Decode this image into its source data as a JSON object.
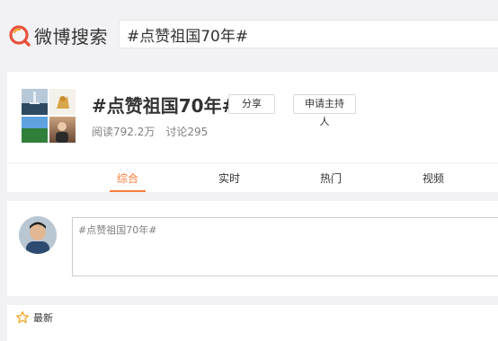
{
  "header": {
    "logo_text": "微博搜索",
    "search_value": "#点赞祖国70年#"
  },
  "topic": {
    "title": "#点赞祖国70年#",
    "share_label": "分享",
    "host_label": "申请主持人",
    "reads": "阅读792.2万",
    "discussions": "讨论295"
  },
  "tabs": [
    {
      "label": "综合",
      "active": true
    },
    {
      "label": "实时",
      "active": false
    },
    {
      "label": "热门",
      "active": false
    },
    {
      "label": "视频",
      "active": false
    }
  ],
  "composer": {
    "value": "#点赞祖国70年#"
  },
  "latest": {
    "label": "最新"
  },
  "colors": {
    "accent": "#fa7d3c",
    "page_bg": "#f2f2f5"
  }
}
